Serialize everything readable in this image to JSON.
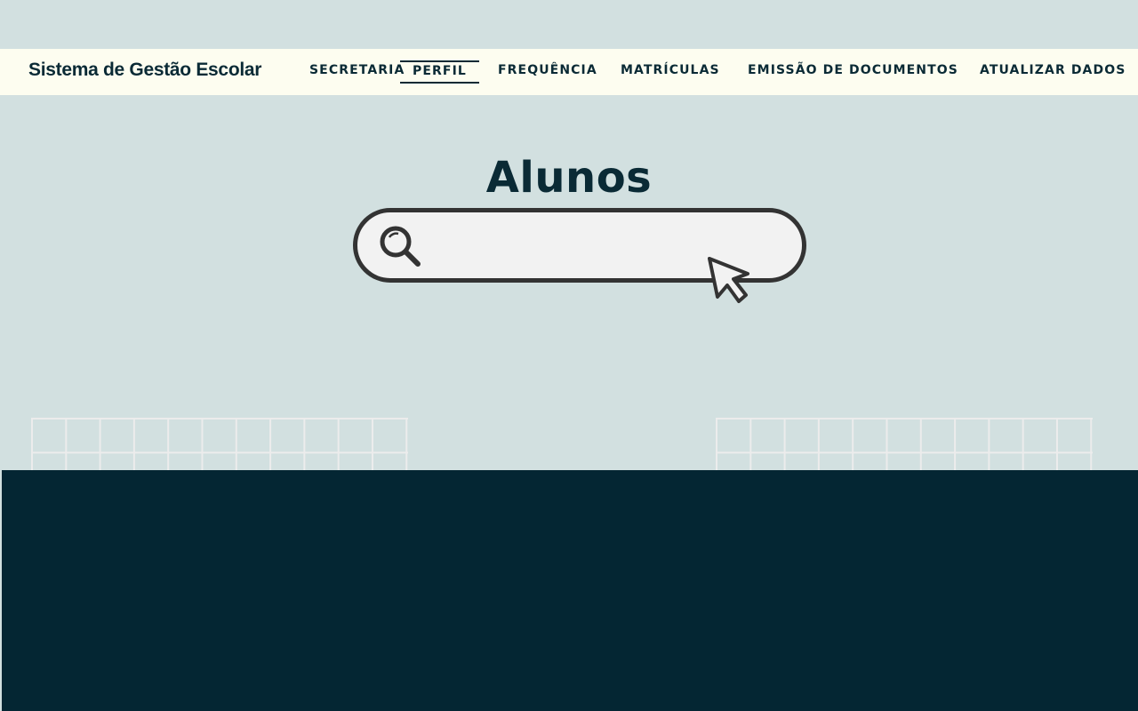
{
  "app": {
    "title": "Sistema de Gestão Escolar"
  },
  "nav": {
    "items": [
      {
        "label": "SECRETARIA"
      },
      {
        "label": "PERFIL",
        "active": true
      },
      {
        "label": "FREQUÊNCIA"
      },
      {
        "label": "MATRÍCULAS"
      },
      {
        "label": "EMISSÃO DE DOCUMENTOS"
      },
      {
        "label": "ATUALIZAR DADOS"
      }
    ]
  },
  "main": {
    "heading": "Alunos"
  },
  "search": {
    "value": "",
    "icon": "search-icon"
  },
  "icons": {
    "cursor": "cursor-icon"
  },
  "colors": {
    "background": "#d2e0e0",
    "navbar": "#fdfdf0",
    "text": "#0a2a35",
    "footer": "#042633",
    "search_fill": "#f2f2f2",
    "search_border": "#333333"
  }
}
